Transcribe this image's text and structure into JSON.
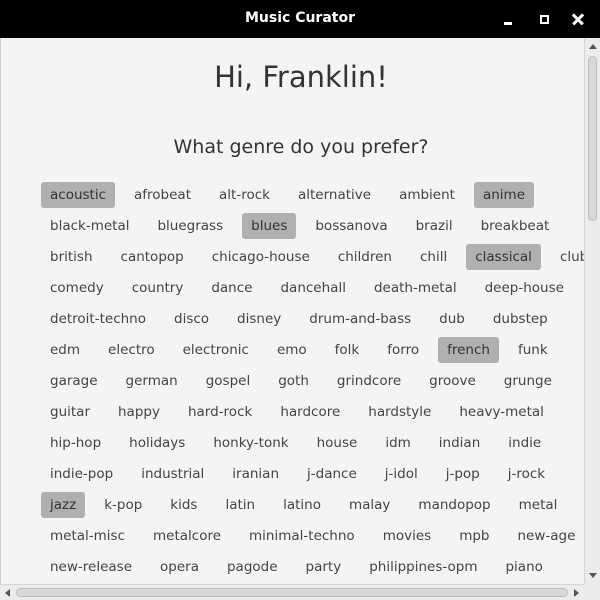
{
  "window": {
    "title": "Music Curator"
  },
  "icons": {
    "minimize": "minimize-icon",
    "maximize": "maximize-icon",
    "close": "close-icon"
  },
  "colors": {
    "titlebar": "#000000",
    "selected_chip": "#b0b0b0",
    "background": "#f4f4f4"
  },
  "content": {
    "greeting": "Hi, Franklin!",
    "question": "What genre do you prefer?"
  },
  "genre_rows": [
    [
      {
        "label": "acoustic",
        "selected": true
      },
      {
        "label": "afrobeat",
        "selected": false
      },
      {
        "label": "alt-rock",
        "selected": false
      },
      {
        "label": "alternative",
        "selected": false
      },
      {
        "label": "ambient",
        "selected": false
      },
      {
        "label": "anime",
        "selected": true
      }
    ],
    [
      {
        "label": "black-metal",
        "selected": false
      },
      {
        "label": "bluegrass",
        "selected": false
      },
      {
        "label": "blues",
        "selected": true
      },
      {
        "label": "bossanova",
        "selected": false
      },
      {
        "label": "brazil",
        "selected": false
      },
      {
        "label": "breakbeat",
        "selected": false
      }
    ],
    [
      {
        "label": "british",
        "selected": false
      },
      {
        "label": "cantopop",
        "selected": false
      },
      {
        "label": "chicago-house",
        "selected": false
      },
      {
        "label": "children",
        "selected": false
      },
      {
        "label": "chill",
        "selected": false
      },
      {
        "label": "classical",
        "selected": true
      },
      {
        "label": "club",
        "selected": false
      }
    ],
    [
      {
        "label": "comedy",
        "selected": false
      },
      {
        "label": "country",
        "selected": false
      },
      {
        "label": "dance",
        "selected": false
      },
      {
        "label": "dancehall",
        "selected": false
      },
      {
        "label": "death-metal",
        "selected": false
      },
      {
        "label": "deep-house",
        "selected": false
      }
    ],
    [
      {
        "label": "detroit-techno",
        "selected": false
      },
      {
        "label": "disco",
        "selected": false
      },
      {
        "label": "disney",
        "selected": false
      },
      {
        "label": "drum-and-bass",
        "selected": false
      },
      {
        "label": "dub",
        "selected": false
      },
      {
        "label": "dubstep",
        "selected": false
      }
    ],
    [
      {
        "label": "edm",
        "selected": false
      },
      {
        "label": "electro",
        "selected": false
      },
      {
        "label": "electronic",
        "selected": false
      },
      {
        "label": "emo",
        "selected": false
      },
      {
        "label": "folk",
        "selected": false
      },
      {
        "label": "forro",
        "selected": false
      },
      {
        "label": "french",
        "selected": true
      },
      {
        "label": "funk",
        "selected": false
      }
    ],
    [
      {
        "label": "garage",
        "selected": false
      },
      {
        "label": "german",
        "selected": false
      },
      {
        "label": "gospel",
        "selected": false
      },
      {
        "label": "goth",
        "selected": false
      },
      {
        "label": "grindcore",
        "selected": false
      },
      {
        "label": "groove",
        "selected": false
      },
      {
        "label": "grunge",
        "selected": false
      }
    ],
    [
      {
        "label": "guitar",
        "selected": false
      },
      {
        "label": "happy",
        "selected": false
      },
      {
        "label": "hard-rock",
        "selected": false
      },
      {
        "label": "hardcore",
        "selected": false
      },
      {
        "label": "hardstyle",
        "selected": false
      },
      {
        "label": "heavy-metal",
        "selected": false
      }
    ],
    [
      {
        "label": "hip-hop",
        "selected": false
      },
      {
        "label": "holidays",
        "selected": false
      },
      {
        "label": "honky-tonk",
        "selected": false
      },
      {
        "label": "house",
        "selected": false
      },
      {
        "label": "idm",
        "selected": false
      },
      {
        "label": "indian",
        "selected": false
      },
      {
        "label": "indie",
        "selected": false
      }
    ],
    [
      {
        "label": "indie-pop",
        "selected": false
      },
      {
        "label": "industrial",
        "selected": false
      },
      {
        "label": "iranian",
        "selected": false
      },
      {
        "label": "j-dance",
        "selected": false
      },
      {
        "label": "j-idol",
        "selected": false
      },
      {
        "label": "j-pop",
        "selected": false
      },
      {
        "label": "j-rock",
        "selected": false
      }
    ],
    [
      {
        "label": "jazz",
        "selected": true
      },
      {
        "label": "k-pop",
        "selected": false
      },
      {
        "label": "kids",
        "selected": false
      },
      {
        "label": "latin",
        "selected": false
      },
      {
        "label": "latino",
        "selected": false
      },
      {
        "label": "malay",
        "selected": false
      },
      {
        "label": "mandopop",
        "selected": false
      },
      {
        "label": "metal",
        "selected": false
      }
    ],
    [
      {
        "label": "metal-misc",
        "selected": false
      },
      {
        "label": "metalcore",
        "selected": false
      },
      {
        "label": "minimal-techno",
        "selected": false
      },
      {
        "label": "movies",
        "selected": false
      },
      {
        "label": "mpb",
        "selected": false
      },
      {
        "label": "new-age",
        "selected": false
      }
    ],
    [
      {
        "label": "new-release",
        "selected": false
      },
      {
        "label": "opera",
        "selected": false
      },
      {
        "label": "pagode",
        "selected": false
      },
      {
        "label": "party",
        "selected": false
      },
      {
        "label": "philippines-opm",
        "selected": false
      },
      {
        "label": "piano",
        "selected": false
      }
    ]
  ]
}
